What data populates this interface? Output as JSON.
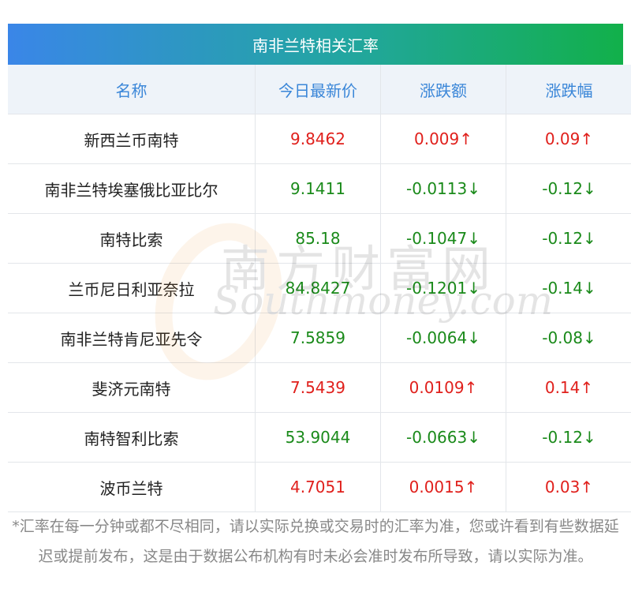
{
  "title": "南非兰特相关汇率",
  "headers": [
    "名称",
    "今日最新价",
    "涨跌额",
    "涨跌幅"
  ],
  "rows": [
    {
      "name": "新西兰币南特",
      "price": "9.8462",
      "change": "0.009↑",
      "pct": "0.09↑",
      "dir": "up"
    },
    {
      "name": "南非兰特埃塞俄比亚比尔",
      "price": "9.1411",
      "change": "-0.0113↓",
      "pct": "-0.12↓",
      "dir": "down"
    },
    {
      "name": "南特比索",
      "price": "85.18",
      "change": "-0.1047↓",
      "pct": "-0.12↓",
      "dir": "down"
    },
    {
      "name": "兰币尼日利亚奈拉",
      "price": "84.8427",
      "change": "-0.1201↓",
      "pct": "-0.14↓",
      "dir": "down"
    },
    {
      "name": "南非兰特肯尼亚先令",
      "price": "7.5859",
      "change": "-0.0064↓",
      "pct": "-0.08↓",
      "dir": "down"
    },
    {
      "name": "斐济元南特",
      "price": "7.5439",
      "change": "0.0109↑",
      "pct": "0.14↑",
      "dir": "up"
    },
    {
      "name": "南特智利比索",
      "price": "53.9044",
      "change": "-0.0663↓",
      "pct": "-0.12↓",
      "dir": "down"
    },
    {
      "name": "波币兰特",
      "price": "4.7051",
      "change": "0.0015↑",
      "pct": "0.03↑",
      "dir": "up"
    }
  ],
  "note": "*汇率在每一分钟或都不尽相同，请以实际兑换或交易时的汇率为准，您或许看到有些数据延迟或提前发布，这是由于数据公布机构有时未必会准时发布所导致，请以实际为准。",
  "watermark": {
    "cn": "南方财富网",
    "en": "Southmoney.com"
  },
  "colors": {
    "up": "#e0201c",
    "down": "#1a8a1a",
    "header_text": "#3a86d8"
  }
}
